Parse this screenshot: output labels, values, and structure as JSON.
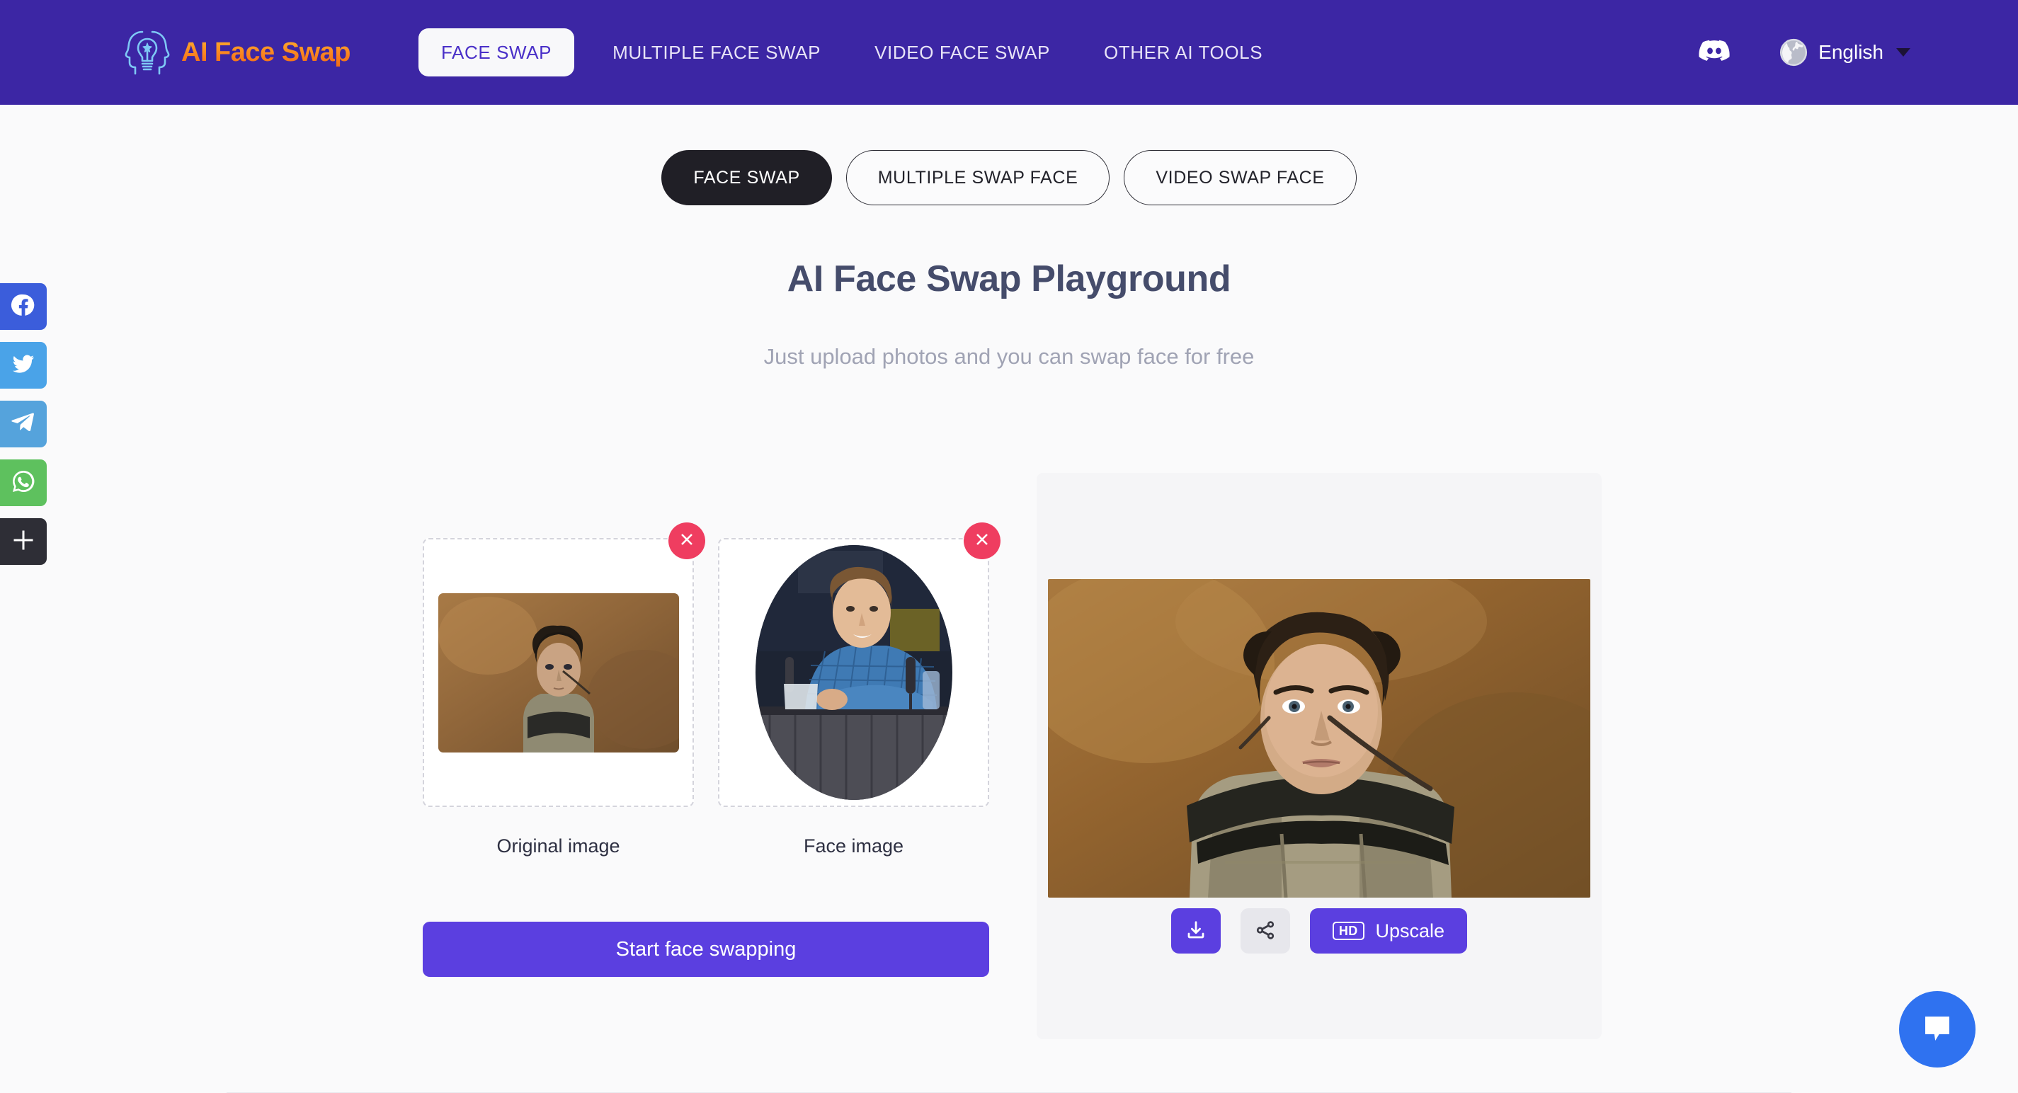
{
  "header": {
    "logo_text": "AI Face Swap",
    "logo_icon": "two-heads-lightbulb-icon",
    "nav": [
      {
        "label": "FACE SWAP",
        "active": true
      },
      {
        "label": "MULTIPLE FACE SWAP",
        "active": false
      },
      {
        "label": "VIDEO FACE SWAP",
        "active": false
      },
      {
        "label": "OTHER AI TOOLS",
        "active": false
      }
    ],
    "discord_icon": "discord-icon",
    "globe_icon": "globe-icon",
    "language": "English",
    "background_color": "#3c26a4",
    "accent_color": "#f7931e"
  },
  "social_rail": [
    {
      "name": "facebook",
      "color": "#3b5ddb"
    },
    {
      "name": "twitter",
      "color": "#4aa3e8"
    },
    {
      "name": "telegram",
      "color": "#55a3dc"
    },
    {
      "name": "whatsapp",
      "color": "#5ec15e"
    },
    {
      "name": "share-more",
      "color": "#2e2e36"
    }
  ],
  "tabs": [
    {
      "label": "FACE SWAP",
      "active": true
    },
    {
      "label": "MULTIPLE SWAP FACE",
      "active": false
    },
    {
      "label": "VIDEO SWAP FACE",
      "active": false
    }
  ],
  "main": {
    "title": "AI Face Swap Playground",
    "subtitle": "Just upload photos and you can swap face for free",
    "uploads": [
      {
        "label": "Original image",
        "shape": "rect",
        "has_image": true,
        "remove_icon": "close-icon"
      },
      {
        "label": "Face image",
        "shape": "circle",
        "has_image": true,
        "remove_icon": "close-icon"
      }
    ],
    "start_button": "Start face swapping",
    "result": {
      "has_image": true,
      "actions": [
        {
          "name": "download",
          "icon": "download-icon",
          "label": ""
        },
        {
          "name": "share",
          "icon": "share-icon",
          "label": ""
        },
        {
          "name": "upscale",
          "icon": "hd-badge-icon",
          "badge": "HD",
          "label": "Upscale"
        }
      ]
    }
  },
  "chat_widget": {
    "icon": "chat-bubble-icon",
    "color": "#2f72f0"
  },
  "colors": {
    "primary_purple": "#5b3fe0",
    "header_purple": "#3c26a4",
    "page_background": "#fafafb",
    "remove_red": "#ef3d60",
    "title_text": "#454c6b",
    "subtitle_text": "#a0a3b4"
  }
}
